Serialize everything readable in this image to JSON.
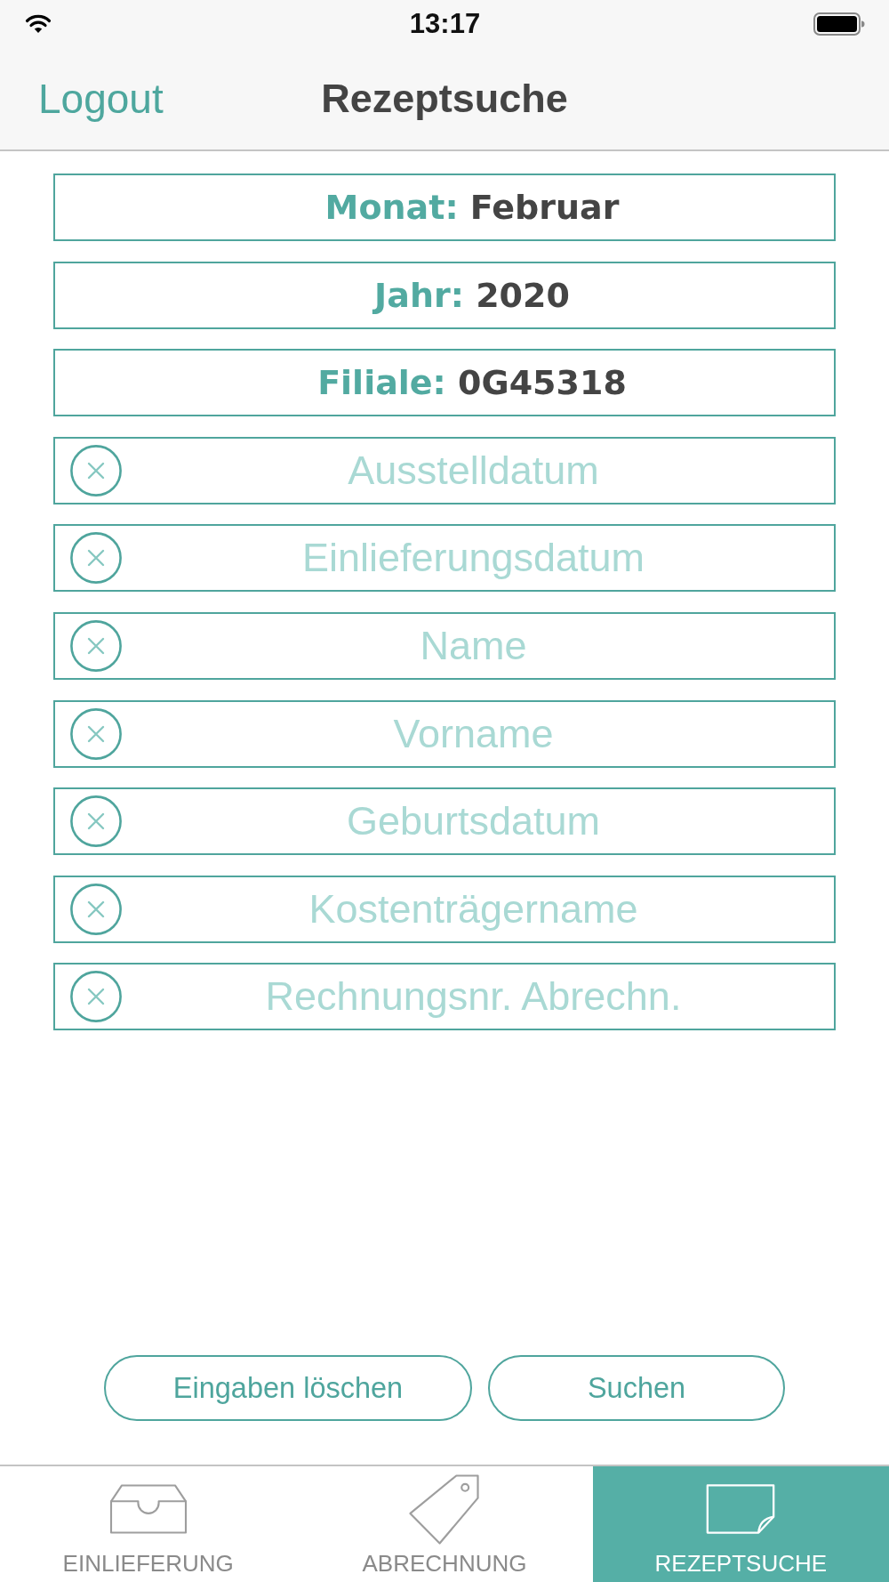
{
  "status_bar": {
    "time": "13:17"
  },
  "nav_bar": {
    "left_button": "Logout",
    "title": "Rezeptsuche"
  },
  "selectors": [
    {
      "label": "Monat:",
      "value": "Februar"
    },
    {
      "label": "Jahr:",
      "value": "2020"
    },
    {
      "label": "Filiale:",
      "value": "0G45318"
    }
  ],
  "search_fields": [
    {
      "placeholder": "Ausstelldatum"
    },
    {
      "placeholder": "Einlieferungsdatum"
    },
    {
      "placeholder": "Name"
    },
    {
      "placeholder": "Vorname"
    },
    {
      "placeholder": "Geburtsdatum"
    },
    {
      "placeholder": "Kostenträgername"
    },
    {
      "placeholder": "Rechnungsnr. Abrechn."
    }
  ],
  "buttons": [
    "Eingaben löschen",
    "Suchen"
  ],
  "tab_bar": [
    {
      "label": "EINLIEFERUNG",
      "selected": false
    },
    {
      "label": "ABRECHNUNG",
      "selected": false
    },
    {
      "label": "REZEPTSUCHE",
      "selected": true
    }
  ]
}
